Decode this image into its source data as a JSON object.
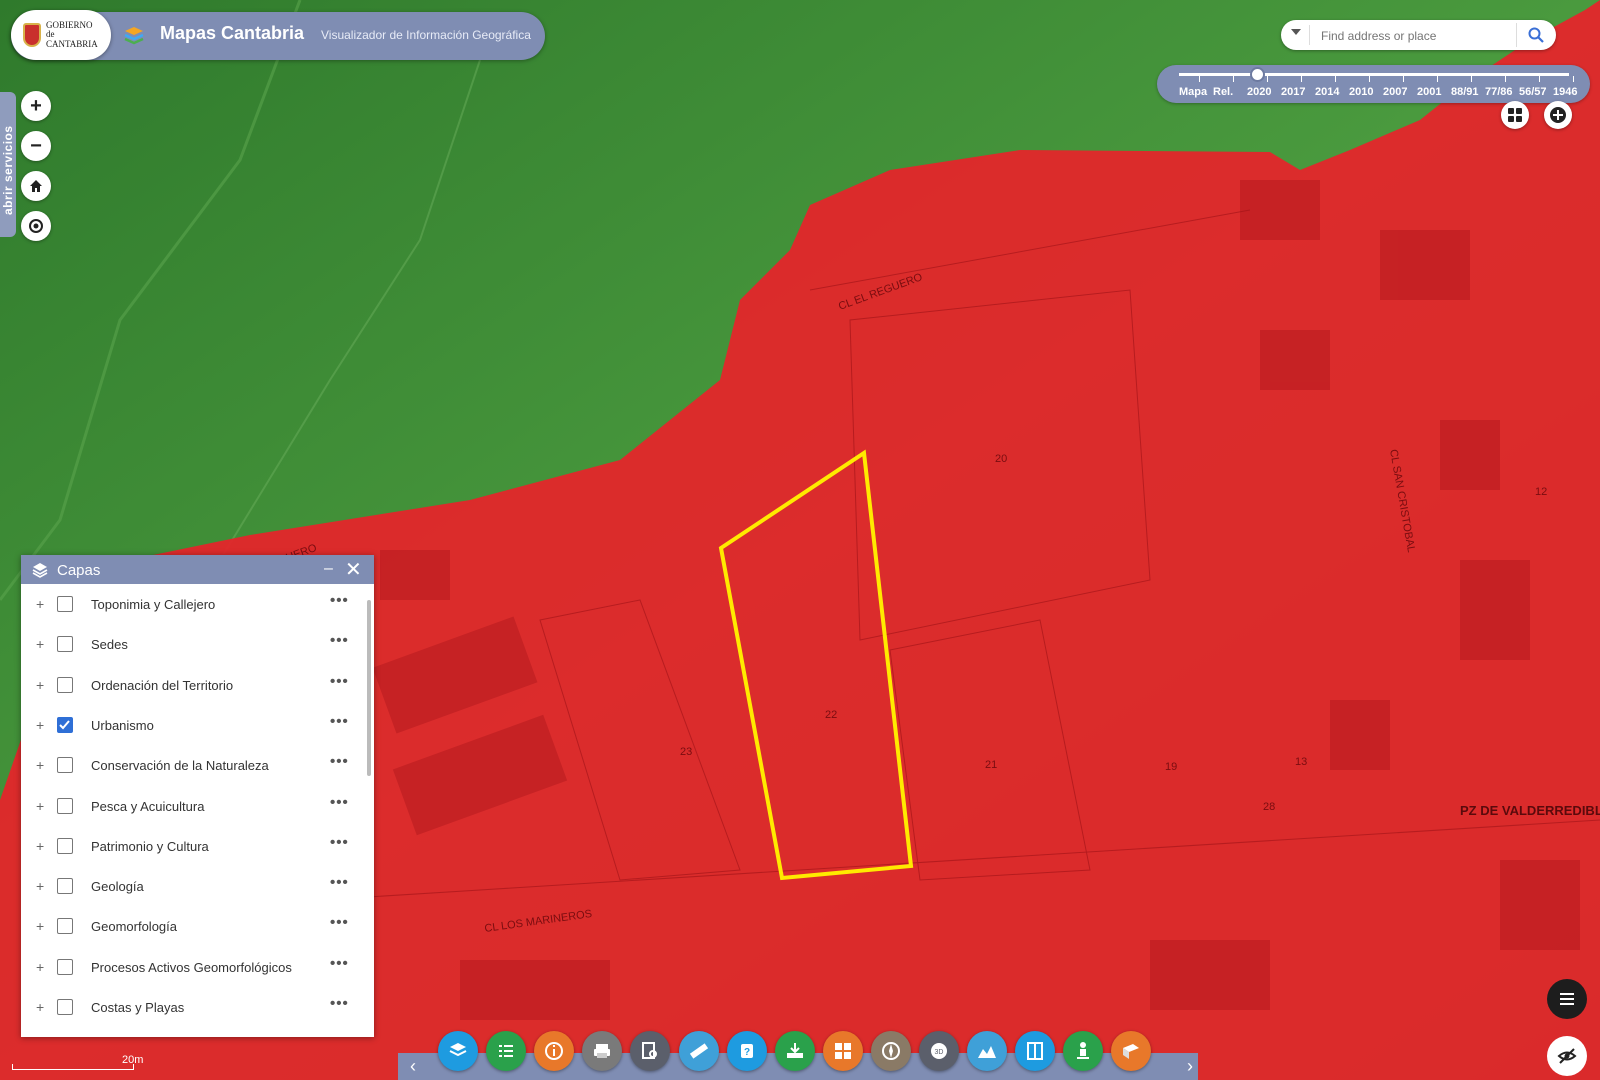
{
  "header": {
    "logo_text": "GOBIERNO de CANTABRIA",
    "title": "Mapas Cantabria",
    "subtitle": "Visualizador de Información Geográfica"
  },
  "search": {
    "placeholder": "Find address or place"
  },
  "timeline": {
    "labels": [
      "Mapa",
      "Rel.",
      "2020",
      "2017",
      "2014",
      "2010",
      "2007",
      "2001",
      "88/91",
      "77/86",
      "56/57",
      "1946"
    ],
    "selected": "2020"
  },
  "side_tab": {
    "label": "abrir servicios"
  },
  "map_labels": {
    "street_1": "CL EL REGUERO",
    "street_2": "CL SAN CRISTOBAL",
    "street_3": "CL LOS MARINEROS",
    "street_4": "PZ DE VALDERREDIBLE",
    "street_5": "EL REGUERO",
    "parcel_a": "22",
    "parcel_b": "23",
    "parcel_c": "21",
    "parcel_d": "20",
    "parcel_e": "19",
    "parcel_f": "12",
    "parcel_g": "13",
    "parcel_h": "28"
  },
  "panel": {
    "title": "Capas",
    "layers": [
      {
        "label": "Toponimia y Callejero",
        "checked": false
      },
      {
        "label": "Sedes",
        "checked": false
      },
      {
        "label": "Ordenación del Territorio",
        "checked": false
      },
      {
        "label": "Urbanismo",
        "checked": true
      },
      {
        "label": "Conservación de la Naturaleza",
        "checked": false
      },
      {
        "label": "Pesca y Acuicultura",
        "checked": false
      },
      {
        "label": "Patrimonio y Cultura",
        "checked": false
      },
      {
        "label": "Geología",
        "checked": false
      },
      {
        "label": "Geomorfología",
        "checked": false
      },
      {
        "label": "Procesos Activos Geomorfológicos",
        "checked": false
      },
      {
        "label": "Costas y Playas",
        "checked": false
      }
    ]
  },
  "scale": {
    "label": "20m"
  },
  "toolbar": {
    "colors": [
      "#1e9be0",
      "#2aa14b",
      "#e8782a",
      "#7a7a7a",
      "#5b5f6b",
      "#3fa0d8",
      "#1e9be0",
      "#2aa14b",
      "#e8782a",
      "#8a7a66",
      "#5b5f6b",
      "#3fa0d8",
      "#1e9be0",
      "#2aa14b",
      "#e8782a"
    ]
  },
  "colors": {
    "accent": "#7f8db3",
    "zone_red": "#e8232a",
    "vegetation": "#3f8a3a",
    "parcel_outline": "#ffea00"
  }
}
